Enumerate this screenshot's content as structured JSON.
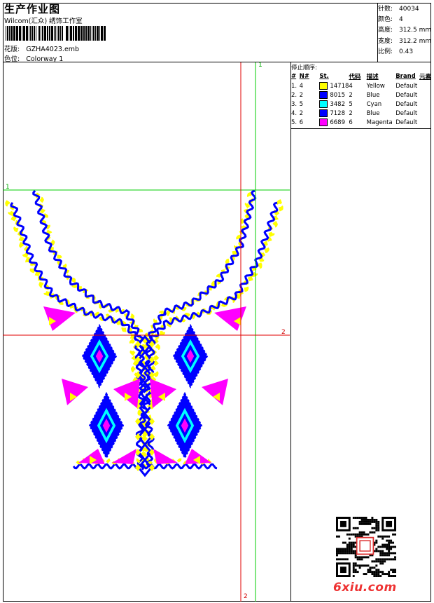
{
  "header": {
    "title": "生产作业图",
    "studio": "Wilcom(汇众) 绣饰工作室",
    "design_label": "花版:",
    "design_value": "GZHA4023.emb",
    "colorway_label": "色位:",
    "colorway_value": "Colorway 1"
  },
  "stats": [
    {
      "key": "针数:",
      "value": "40034"
    },
    {
      "key": "颜色:",
      "value": "4"
    },
    {
      "key": "高度:",
      "value": "312.5 mm"
    },
    {
      "key": "宽度:",
      "value": "312.2 mm"
    },
    {
      "key": "比例:",
      "value": "0.43"
    }
  ],
  "legend": {
    "title": "停止顺序:",
    "columns": [
      "#",
      "N#",
      "St.",
      "代码",
      "描述",
      "Brand",
      "元素"
    ],
    "rows": [
      {
        "num": "1.",
        "n": "4",
        "color": "#ffff00",
        "st": "14718",
        "code": "4",
        "desc": "Yellow",
        "brand": "Default"
      },
      {
        "num": "2.",
        "n": "2",
        "color": "#0000ff",
        "st": "8015",
        "code": "2",
        "desc": "Blue",
        "brand": "Default"
      },
      {
        "num": "3.",
        "n": "5",
        "color": "#00ffff",
        "st": "3482",
        "code": "5",
        "desc": "Cyan",
        "brand": "Default"
      },
      {
        "num": "4.",
        "n": "2",
        "color": "#0000ff",
        "st": "7128",
        "code": "2",
        "desc": "Blue",
        "brand": "Default"
      },
      {
        "num": "5.",
        "n": "6",
        "color": "#ff00ff",
        "st": "6689",
        "code": "6",
        "desc": "Magenta",
        "brand": "Default"
      }
    ]
  },
  "guides": {
    "green_top": "1",
    "green_left": "1",
    "red_right": "2",
    "red_bottom": "2"
  },
  "colors": {
    "yellow": "#ffff00",
    "blue": "#0000ff",
    "cyan": "#00ffff",
    "magenta": "#ff00ff",
    "guide_green": "#00cc00",
    "guide_red": "#e00000"
  },
  "watermark": {
    "site": "6xiu.com",
    "qr_icon": "qr-code-icon"
  }
}
